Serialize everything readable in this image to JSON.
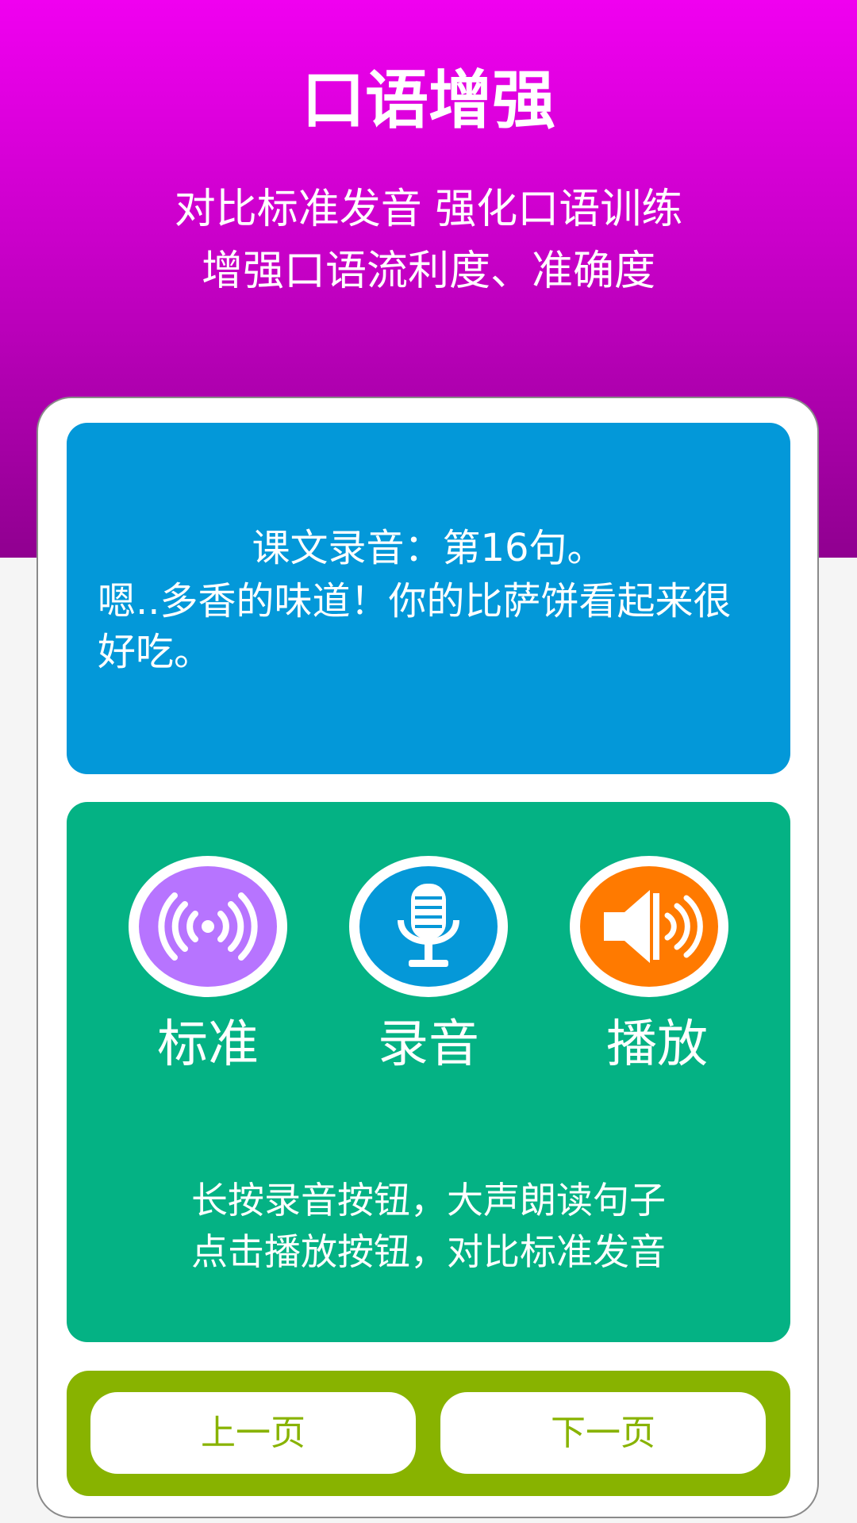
{
  "header": {
    "title": "口语增强",
    "subtitle_line1": "对比标准发音 强化口语训练",
    "subtitle_line2": "增强口语流利度、准确度"
  },
  "sentence": {
    "heading": "课文录音：第16句。",
    "text": "嗯..多香的味道！你的比萨饼看起来很好吃。"
  },
  "controls": [
    {
      "label": "标准",
      "icon": "radio-wave-icon",
      "color": "#b774ff"
    },
    {
      "label": "录音",
      "icon": "microphone-icon",
      "color": "#0598d8"
    },
    {
      "label": "播放",
      "icon": "speaker-icon",
      "color": "#ff7a00"
    }
  ],
  "hints": {
    "line1": "长按录音按钮，大声朗读句子",
    "line2": "点击播放按钮，对比标准发音"
  },
  "nav": {
    "prev_label": "上一页",
    "next_label": "下一页"
  },
  "colors": {
    "header_gradient_top": "#f000f0",
    "header_gradient_bottom": "#900090",
    "sentence_panel": "#0398d9",
    "controls_panel": "#04b284",
    "nav_panel": "#88b300"
  }
}
